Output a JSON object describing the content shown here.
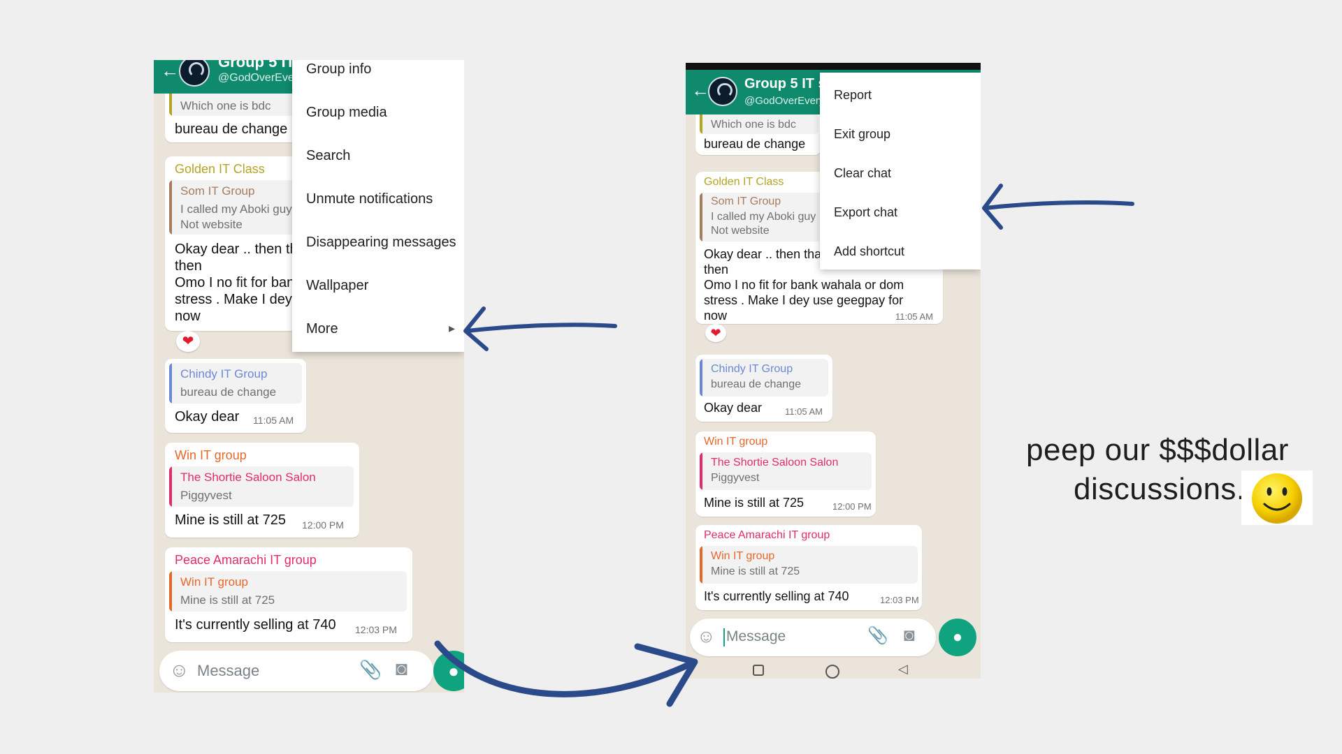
{
  "colors": {
    "header_green": "#0f8a6c",
    "mic_green": "#0fa37f",
    "arrow_navy": "#2b4a8a",
    "golden": "#b5a424",
    "brown": "#a77b5e",
    "blue": "#6b88d6",
    "orange": "#e6672a",
    "pink": "#e22b6a"
  },
  "left_phone": {
    "header_title": "Group 5 IT",
    "header_subtitle": "@GodOverEvery",
    "top_quote_text": "Which one is bdc",
    "top_msg": "bureau de change",
    "golden": {
      "sender": "Golden IT Class",
      "quote_name": "Som IT Group",
      "quote_text_1": "I called my Aboki guy",
      "quote_text_2": "Not website",
      "line1": "Okay dear .. then that",
      "line2": "then",
      "line3": "Omo I no fit for bank wahala or dom",
      "line4": "stress . Make I dey use geegpay for",
      "line5": "now",
      "reaction": "❤"
    },
    "chindy": {
      "quote_name": "Chindy IT Group",
      "quote_text": "bureau de change",
      "msg": "Okay dear",
      "time": "11:05 AM"
    },
    "win": {
      "sender": "Win IT group",
      "quote_name": "The Shortie Saloon Salon",
      "quote_text": "Piggyvest",
      "msg": "Mine is still at 725",
      "time": "12:00 PM"
    },
    "peace": {
      "sender": "Peace Amarachi IT group",
      "quote_name": "Win IT group",
      "quote_text": "Mine is still at 725",
      "msg": "It's currently selling at 740",
      "time": "12:03 PM"
    },
    "input_placeholder": "Message",
    "menu": [
      "Group info",
      "Group media",
      "Search",
      "Unmute notifications",
      "Disappearing messages",
      "Wallpaper",
      "More"
    ],
    "menu_more_chevron": "▸"
  },
  "right_phone": {
    "header_title": "Group 5 IT s",
    "header_subtitle": "@GodOverEvery",
    "top_quote_text": "Which one is bdc",
    "top_msg": "bureau de change",
    "golden": {
      "sender": "Golden IT Class",
      "quote_name": "Som IT Group",
      "quote_text_1": "I called my Aboki guy",
      "quote_text_2": "Not website",
      "line1": "Okay dear .. then that",
      "line2": "then",
      "line3": "Omo I no fit for bank wahala or dom",
      "line4": "stress . Make I dey use geegpay for",
      "line5": "now",
      "time": "11:05 AM",
      "reaction": "❤"
    },
    "chindy": {
      "quote_name": "Chindy IT Group",
      "quote_text": "bureau de change",
      "msg": "Okay dear",
      "time": "11:05 AM"
    },
    "win": {
      "sender": "Win IT group",
      "quote_name": "The Shortie Saloon Salon",
      "quote_text": "Piggyvest",
      "msg": "Mine is still at 725",
      "time": "12:00 PM"
    },
    "peace": {
      "sender": "Peace Amarachi IT group",
      "quote_name": "Win IT group",
      "quote_text": "Mine is still at 725",
      "msg": "It's currently selling at 740",
      "time": "12:03 PM"
    },
    "input_placeholder": "Message",
    "menu": [
      "Report",
      "Exit group",
      "Clear chat",
      "Export chat",
      "Add shortcut"
    ]
  },
  "caption": {
    "line1": "peep our $$$dollar",
    "line2": "discussions."
  },
  "icons": {
    "back": "back-arrow-icon",
    "emoji": "emoji-icon",
    "attach": "paperclip-icon",
    "camera": "camera-icon",
    "mic": "microphone-icon",
    "smiley": "smiley-face-icon"
  }
}
